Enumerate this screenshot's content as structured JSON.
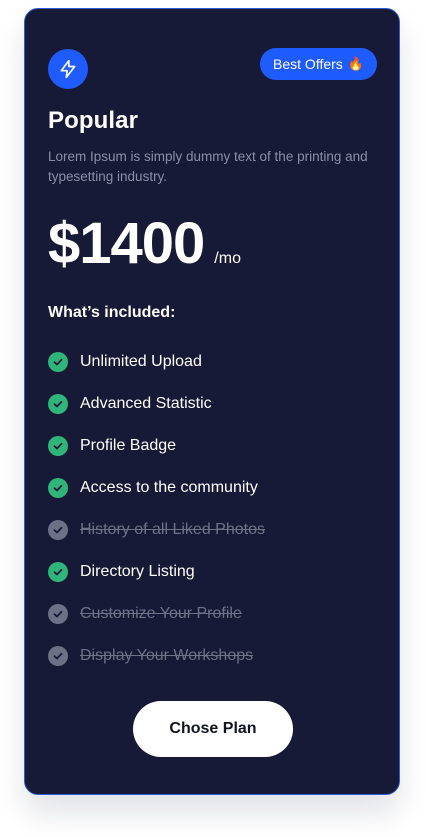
{
  "plan": {
    "icon": "lightning-bolt-icon",
    "badge_label": "Best Offers",
    "badge_emoji": "🔥",
    "name": "Popular",
    "description": "Lorem Ipsum is simply dummy text of the printing and typesetting industry.",
    "price": "$1400",
    "period": "/mo",
    "included_heading": "What’s included:",
    "features": [
      {
        "label": "Unlimited Upload",
        "included": true
      },
      {
        "label": "Advanced Statistic",
        "included": true
      },
      {
        "label": "Profile Badge",
        "included": true
      },
      {
        "label": "Access to the community",
        "included": true
      },
      {
        "label": "History of all Liked Photos",
        "included": false
      },
      {
        "label": "Directory Listing",
        "included": true
      },
      {
        "label": "Customize Your Profile",
        "included": false
      },
      {
        "label": "Display Your Workshops",
        "included": false
      }
    ],
    "cta_label": "Chose Plan"
  },
  "colors": {
    "card_background": "#171a36",
    "accent_blue": "#1f5cff",
    "check_included": "#2fb57a",
    "check_excluded": "#6d7186"
  }
}
